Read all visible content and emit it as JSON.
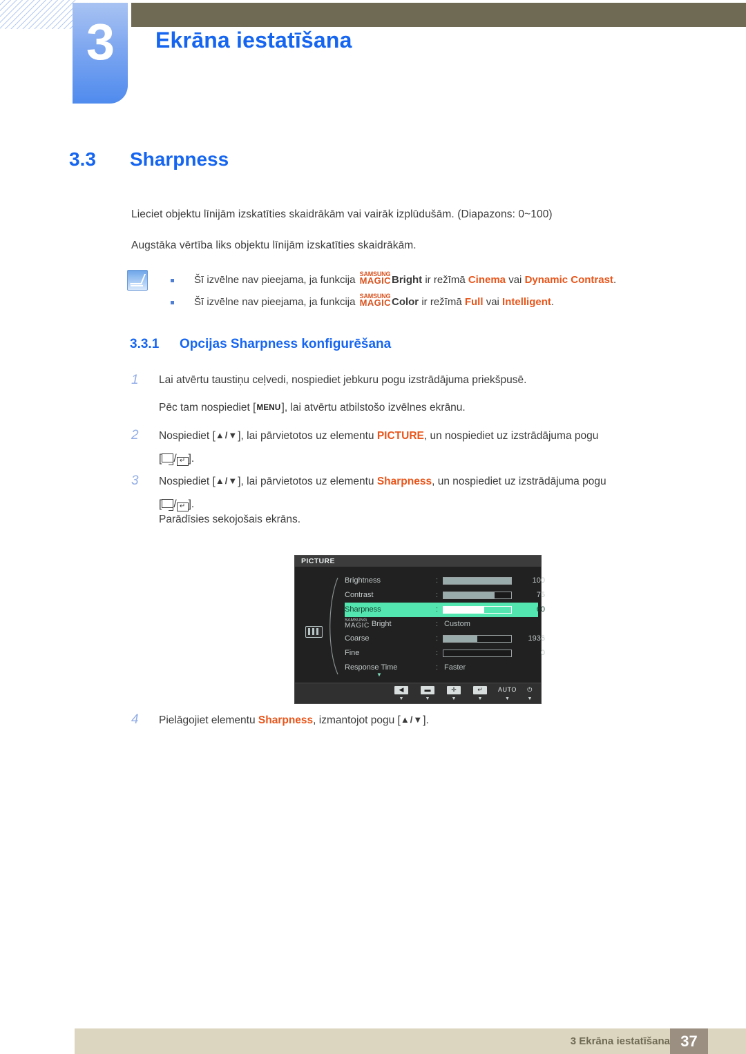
{
  "header": {
    "chapter_number": "3",
    "chapter_title": "Ekrāna iestatīšana",
    "bar_color": "#6f6a53",
    "tab_color": "#7ba5f0",
    "title_color": "#1565f0"
  },
  "section": {
    "number": "3.3",
    "title": "Sharpness"
  },
  "intro": {
    "paragraph_1": "Lieciet objektu līnijām izskatīties skaidrākām vai vairāk izplūdušām. (Diapazons: 0~100)",
    "paragraph_2": "Augstāka vērtība liks objektu līnijām izskatīties skaidrākām."
  },
  "note": {
    "icon": "note-pencil-icon",
    "bullets": [
      {
        "pre": "Šī izvēlne nav pieejama, ja funkcija",
        "magic_top": "SAMSUNG",
        "magic_bottom": "MAGIC",
        "feature": "Bright",
        "mid": "ir režīmā",
        "value_1": "Cinema",
        "conj": "vai",
        "value_2": "Dynamic Contrast",
        "end": "."
      },
      {
        "pre": "Šī izvēlne nav pieejama, ja funkcija",
        "magic_top": "SAMSUNG",
        "magic_bottom": "MAGIC",
        "feature": "Color",
        "mid": "ir režīmā",
        "value_1": "Full",
        "conj": "vai",
        "value_2": "Intelligent",
        "end": "."
      }
    ]
  },
  "subsection": {
    "number": "3.3.1",
    "title": "Opcijas Sharpness konfigurēšana"
  },
  "steps": [
    {
      "index": "1",
      "text": "Lai atvērtu taustiņu ceļvedi, nospiediet jebkuru pogu izstrādājuma priekšpusē."
    },
    {
      "index": "",
      "text_pre": "Pēc tam nospiediet [",
      "key": "MENU",
      "text_post": "], lai atvērtu atbilstošo izvēlnes ekrānu."
    },
    {
      "index": "2",
      "text_pre": "Nospiediet [",
      "keys": "▲/▼",
      "text_mid": "], lai pārvietotos uz elementu",
      "highlight": "PICTURE",
      "text_post": ", un nospiediet uz izstrādājuma pogu"
    },
    {
      "index": "3",
      "text_pre": "Nospiediet [",
      "keys": "▲/▼",
      "text_mid": "], lai pārvietotos uz elementu",
      "highlight": "Sharpness",
      "text_post": ", un nospiediet uz izstrādājuma pogu"
    },
    {
      "index": "",
      "text": "Parādīsies sekojošais ekrāns."
    },
    {
      "index": "4",
      "text_pre": "Pielāgojiet elementu",
      "highlight": "Sharpness",
      "text_mid": ", izmantojot pogu [",
      "keys": "▲/▼",
      "text_post": "]."
    }
  ],
  "osd": {
    "title": "PICTURE",
    "category_icon": "picture-bars-icon",
    "rows": [
      {
        "label": "Brightness",
        "type": "bar",
        "value": "100",
        "fill": 100,
        "selected": false
      },
      {
        "label": "Contrast",
        "type": "bar",
        "value": "75",
        "fill": 75,
        "selected": false
      },
      {
        "label": "Sharpness",
        "type": "bar",
        "value": "60",
        "fill": 60,
        "selected": true
      },
      {
        "label": "Bright",
        "type": "text",
        "value": "Custom",
        "magic_top": "SAMSUNG",
        "magic_bottom": "MAGIC",
        "selected": false
      },
      {
        "label": "Coarse",
        "type": "bar",
        "value": "1936",
        "fill": 50,
        "selected": false
      },
      {
        "label": "Fine",
        "type": "bar",
        "value": "0",
        "fill": 0,
        "selected": false
      },
      {
        "label": "Response Time",
        "type": "text",
        "value": "Faster",
        "selected": false
      }
    ],
    "scroll_down_indicator": "▼",
    "footer_buttons": [
      {
        "glyph": "◀",
        "name": "left-arrow-button"
      },
      {
        "glyph": "▬",
        "name": "minus-button"
      },
      {
        "glyph": "✛",
        "name": "plus-button"
      },
      {
        "glyph": "↵",
        "name": "enter-button"
      },
      {
        "glyph": "AUTO",
        "name": "auto-button"
      },
      {
        "glyph": "⏻",
        "name": "power-button"
      }
    ],
    "highlight_color": "#54e6b0"
  },
  "footer": {
    "text": "3 Ekrāna iestatīšana",
    "page": "37",
    "band_color": "#dcd6c0",
    "page_box_color": "#9b8f82"
  }
}
